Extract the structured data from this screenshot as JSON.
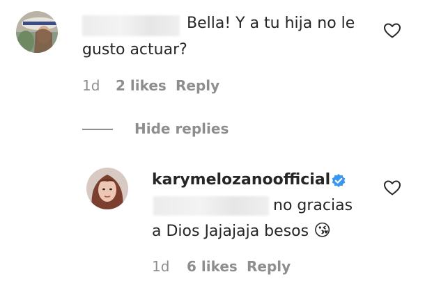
{
  "comment": {
    "text_line1": "Bella! Y a tu hija no le",
    "text_line2": "gusto actuar?",
    "time": "1d",
    "likes": "2 likes",
    "reply": "Reply"
  },
  "hide_replies": "Hide replies",
  "reply_comment": {
    "username": "karymelozanoofficial",
    "text_line1": "no gracias",
    "text_line2": "a Dios Jajajaja besos",
    "emoji": "😘",
    "time": "1d",
    "likes": "6 likes",
    "reply": "Reply"
  },
  "icons": {
    "heart": "heart-outline-icon",
    "verified": "verified-badge-icon"
  },
  "colors": {
    "text": "#262626",
    "muted": "#8e8e8e",
    "verified": "#3897f0"
  }
}
